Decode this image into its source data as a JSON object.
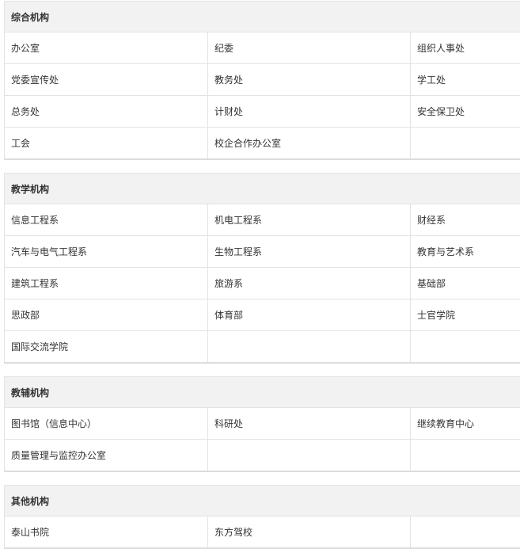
{
  "sections": [
    {
      "title": "综合机构",
      "items": [
        "办公室",
        "纪委",
        "组织人事处",
        "党委宣传处",
        "教务处",
        "学工处",
        "总务处",
        "计财处",
        "安全保卫处",
        "工会",
        "校企合作办公室",
        ""
      ]
    },
    {
      "title": "教学机构",
      "items": [
        "信息工程系",
        "机电工程系",
        "财经系",
        "汽车与电气工程系",
        "生物工程系",
        "教育与艺术系",
        "建筑工程系",
        "旅游系",
        "基础部",
        "思政部",
        "体育部",
        "士官学院",
        "国际交流学院",
        "",
        ""
      ]
    },
    {
      "title": "教辅机构",
      "items": [
        "图书馆（信息中心）",
        "科研处",
        "继续教育中心",
        "质量管理与监控办公室",
        "",
        ""
      ]
    },
    {
      "title": "其他机构",
      "items": [
        "泰山书院",
        "东方驾校",
        ""
      ]
    }
  ]
}
